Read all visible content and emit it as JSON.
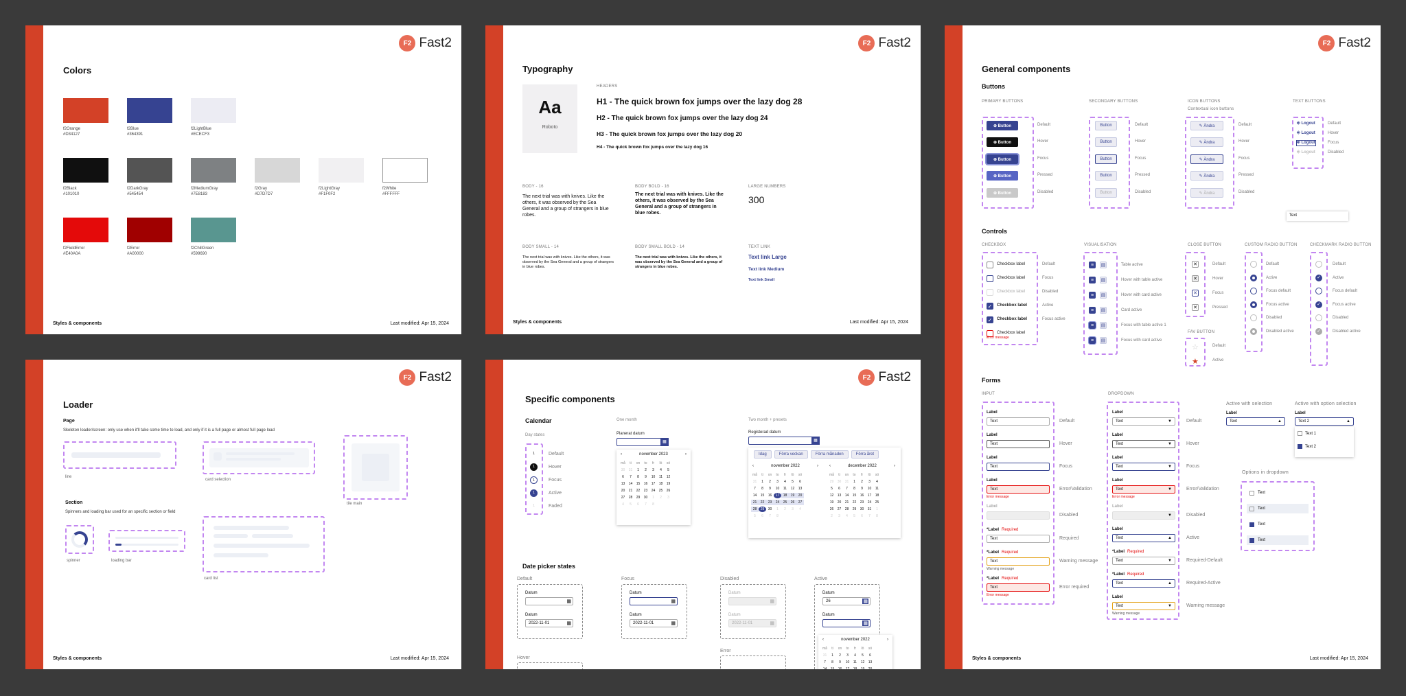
{
  "brand": {
    "logo_badge": "F2",
    "logo_word": "Fast2",
    "footer": "Styles & components",
    "modified": "Last modified: Apr 15, 2024"
  },
  "colors": {
    "title": "Colors",
    "swatches": [
      {
        "name": "f2Orange",
        "hex": "#D34127"
      },
      {
        "name": "f2Blue",
        "hex": "#364391"
      },
      {
        "name": "f2LightBlue",
        "hex": "#ECECF3"
      },
      {
        "name": "f2Black",
        "hex": "#101010"
      },
      {
        "name": "f2DarkGray",
        "hex": "#545454"
      },
      {
        "name": "f2MediumGray",
        "hex": "#7E8183"
      },
      {
        "name": "f2Gray",
        "hex": "#D7D7D7"
      },
      {
        "name": "f2LightGray",
        "hex": "#F1F0F2"
      },
      {
        "name": "f2White",
        "hex": "#FFFFFF"
      },
      {
        "name": "f2FieldError",
        "hex": "#E40A0A"
      },
      {
        "name": "f2Error",
        "hex": "#A00000"
      },
      {
        "name": "f2ChillGreen",
        "hex": "#599690"
      }
    ]
  },
  "typography": {
    "title": "Typography",
    "sample": "Aa",
    "font": "Roboto",
    "headers_label": "HEADERS",
    "h1": "H1 - The quick brown fox jumps over the lazy dog 28",
    "h2": "H2 - The quick brown fox jumps over the lazy dog 24",
    "h3": "H3 - The quick brown fox jumps over the lazy dog 20",
    "h4": "H4 - The quick brown fox jumps over the lazy dog 16",
    "body16_label": "BODY - 16",
    "body_bold16_label": "BODY BOLD - 16",
    "large_numbers_label": "LARGE NUMBERS",
    "body_text": "The next trial was with knives. Like the others, it was observed by the Sea General and a group of strangers in blue robes.",
    "large_number": "300",
    "body14_label": "BODY SMALL - 14",
    "body_bold14_label": "BODY SMALL BOLD - 14",
    "textlink_label": "TEXT LINK",
    "body_small_text": "The next trial was with knives. Like the others, it was observed by the Sea General and a group of strangers in blue robes.",
    "link_large": "Text link Large",
    "link_medium": "Text link Medium",
    "link_small": "Text link Small"
  },
  "general": {
    "title": "General components",
    "buttons_title": "Buttons",
    "primary_hdr": "PRIMARY BUTTONS",
    "secondary_hdr": "SECONDARY BUTTONS",
    "icon_hdr": "ICON BUTTONS",
    "icon_sub": "Contextual icon buttons",
    "text_hdr": "TEXT BUTTONS",
    "button_label": "Button",
    "edit_label": "Ändra",
    "logout_label": "Logout",
    "states": [
      "Default",
      "Hover",
      "Focus",
      "Pressed",
      "Disabled"
    ],
    "tooltip_text": "Text",
    "controls_title": "Controls",
    "checkbox_hdr": "CHECKBOX",
    "checkbox_label": "Checkbox label",
    "error_message": "Error message",
    "checkbox_states": [
      "Default",
      "Focus",
      "Disabled",
      "Active",
      "Focus active"
    ],
    "vis_hdr": "VISUALISATION",
    "vis_states": [
      "Table active",
      "Hover with table active",
      "Hover with card active",
      "Card active",
      "Focus with table active 1",
      "Focus with card active"
    ],
    "close_hdr": "CLOSE BUTTON",
    "close_states": [
      "Default",
      "Hover",
      "Focus",
      "Pressed"
    ],
    "fav_hdr": "FAV BUTTON",
    "fav_states": [
      "Default",
      "Active"
    ],
    "radio_hdr": "CUSTOM RADIO BUTTON",
    "radio_states": [
      "Default",
      "Active",
      "Focus default",
      "Focus active",
      "Disabled",
      "Disabled active"
    ],
    "cmradio_hdr": "CHECKMARK RADIO BUTTON",
    "cmradio_states": [
      "Default",
      "Active",
      "Focus default",
      "Focus active",
      "Disabled",
      "Disabled active"
    ],
    "forms_title": "Forms",
    "input_hdr": "INPUT",
    "dropdown_hdr": "DROPDOWN",
    "field_label": "Label",
    "field_text": "Text",
    "required": "Required",
    "warning_message": "Warning message",
    "input_states": [
      "Default",
      "Hover",
      "Focus",
      "Error/Validation",
      "Disabled",
      "Required",
      "Warning message",
      "Error required"
    ],
    "dropdown_states": [
      "Default",
      "Hover",
      "Focus",
      "Error/Validation",
      "Disabled",
      "Active",
      "Required-Default",
      "Required-Active",
      "Warning message"
    ],
    "active_sel_hdr": "Active with selection",
    "active_opt_hdr": "Active with option selection",
    "opt_text2": "Text 2",
    "opt_text1": "Text 1",
    "options_hdr": "Options in dropdown"
  },
  "loader": {
    "title": "Loader",
    "page_hdr": "Page",
    "page_desc": "Skeleton loader/screen: only use when it'll take some time to load, and only if it is a full page or almost full page load",
    "line": "line",
    "card_selection": "card selection",
    "tile_main": "tile main",
    "section_hdr": "Section",
    "section_desc": "Spinners and loading bar used for an specific section or field",
    "spinner": "spinner",
    "loading_bar": "loading bar",
    "card_list": "card list"
  },
  "specific": {
    "title": "Specific components",
    "calendar_hdr": "Calendar",
    "day_states_hdr": "Day states",
    "day_states": [
      "Default",
      "Hover",
      "Focus",
      "Active",
      "Faded"
    ],
    "one_month_hdr": "One month",
    "planned_label": "Planerat datum",
    "month1": "november 2023",
    "two_month_hdr": "Two month + presets",
    "registered_label": "Registerad datum",
    "presets": [
      "Idag",
      "Förra veckan",
      "Förra månaden",
      "Förra året"
    ],
    "month_a": "november 2022",
    "month_b": "december 2022",
    "weekdays": [
      "må",
      "ti",
      "on",
      "to",
      "fr",
      "lö",
      "sö"
    ],
    "date_picker_hdr": "Date picker states",
    "dp_states": [
      "Default",
      "Focus",
      "Disabled",
      "Active",
      "Hover",
      "Error"
    ],
    "datum": "Datum",
    "date_value": "2022-11-01",
    "typed": "26",
    "month_c": "november 2022"
  }
}
